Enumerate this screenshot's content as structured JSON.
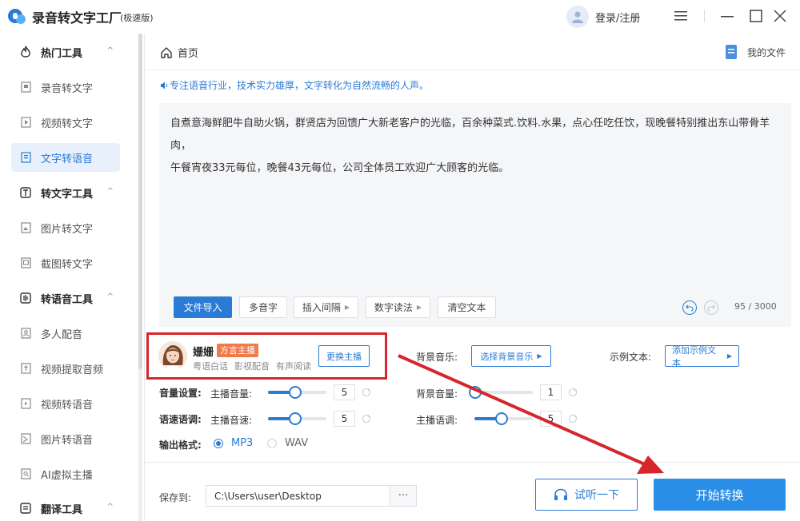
{
  "titlebar": {
    "app_name": "录音转文字工厂",
    "app_edition": "(极速版)",
    "login_label": "登录/注册"
  },
  "sidebar": {
    "groups": [
      {
        "label": "热门工具",
        "icon": "flame-icon",
        "expanded": true
      },
      {
        "label": "转文字工具",
        "icon": "text-t-icon",
        "expanded": true
      },
      {
        "label": "转语音工具",
        "icon": "waveform-icon",
        "expanded": true
      },
      {
        "label": "翻译工具",
        "icon": "translate-icon",
        "expanded": true
      }
    ],
    "items": [
      {
        "label": "录音转文字",
        "icon": "recording-doc-icon"
      },
      {
        "label": "视频转文字",
        "icon": "video-doc-icon"
      },
      {
        "label": "文字转语音",
        "icon": "text-to-speech-icon",
        "active": true
      },
      {
        "label": "图片转文字",
        "icon": "image-doc-icon"
      },
      {
        "label": "截图转文字",
        "icon": "screenshot-doc-icon"
      },
      {
        "label": "多人配音",
        "icon": "person-icon"
      },
      {
        "label": "视频提取音频",
        "icon": "extract-audio-icon"
      },
      {
        "label": "视频转语音",
        "icon": "play-icon"
      },
      {
        "label": "图片转语音",
        "icon": "image-audio-icon"
      },
      {
        "label": "AI虚拟主播",
        "icon": "ai-anchor-icon"
      }
    ],
    "expand_caret": "^"
  },
  "header": {
    "home_label": "首页",
    "my_files_label": "我的文件"
  },
  "slogan": "专注语音行业，技术实力雄厚，文字转化为自然流畅的人声。",
  "editor": {
    "text_line1": "自煮意海鲜肥牛自助火锅，群贤店为回馈广大新老客户的光临，百余种菜式.饮料.水果，点心任吃任饮，现晚餐特别推出东山带骨羊肉，",
    "text_line2": "午餐宵夜33元每位，晚餐43元每位，公司全体员工欢迎广大顾客的光临。",
    "buttons": {
      "import": "文件导入",
      "polyphone": "多音字",
      "insert_pause": "插入间隔",
      "number_reading": "数字读法",
      "clear": "清空文本"
    },
    "char_count": "95 / 3000"
  },
  "anchor": {
    "name": "姗姗",
    "tag": "方言主播",
    "styles": [
      "粤语白话",
      "影视配音",
      "有声阅读"
    ],
    "change_label": "更换主播"
  },
  "settings": {
    "bg_music_label": "背景音乐:",
    "bg_music_button": "选择背景音乐",
    "sample_label": "示例文本:",
    "sample_button": "添加示例文本",
    "volume_label": "音量设置:",
    "anchor_volume_label": "主播音量:",
    "anchor_volume": "5",
    "anchor_volume_fraction": 0.45,
    "bg_volume_label": "背景音量:",
    "bg_volume": "1",
    "bg_volume_fraction": 0.0,
    "speed_pitch_label": "语速语调:",
    "anchor_speed_label": "主播音速:",
    "anchor_speed": "5",
    "anchor_speed_fraction": 0.45,
    "anchor_pitch_label": "主播语调:",
    "anchor_pitch": "5",
    "anchor_pitch_fraction": 0.45,
    "format_label": "输出格式:",
    "formats": [
      {
        "label": "MP3",
        "selected": true
      },
      {
        "label": "WAV",
        "selected": false
      }
    ]
  },
  "footer": {
    "save_to_label": "保存到:",
    "save_path": "C:\\Users\\user\\Desktop",
    "browse_label": "···",
    "listen_label": "试听一下",
    "start_label": "开始转换"
  },
  "colors": {
    "accent": "#2a7bd6",
    "start_button": "#2a8ee8",
    "highlight_box": "#d6262b",
    "tag_orange": "#f07a4a"
  }
}
